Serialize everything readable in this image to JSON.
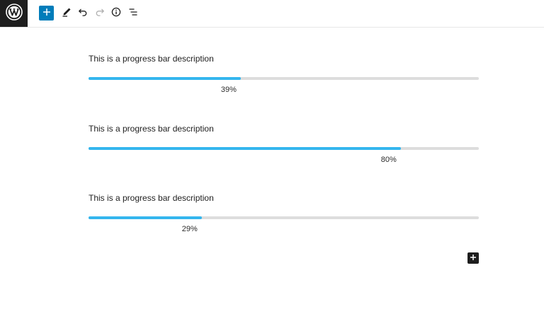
{
  "toolbar": {
    "logo_icon": "wordpress-logo-icon",
    "buttons": [
      {
        "name": "add-block-button",
        "icon": "plus-icon"
      },
      {
        "name": "edit-tools-button",
        "icon": "pencil-icon"
      },
      {
        "name": "undo-button",
        "icon": "undo-icon"
      },
      {
        "name": "redo-button",
        "icon": "redo-icon"
      },
      {
        "name": "details-button",
        "icon": "info-icon"
      },
      {
        "name": "list-view-button",
        "icon": "list-view-icon"
      }
    ],
    "accent_color": "#007cba"
  },
  "progress_bars": [
    {
      "description": "This is a progress bar description",
      "value": 39,
      "label": "39%"
    },
    {
      "description": "This is a progress bar description",
      "value": 80,
      "label": "80%"
    },
    {
      "description": "This is a progress bar description",
      "value": 29,
      "label": "29%"
    }
  ],
  "colors": {
    "bar_fill": "#34b6ee",
    "bar_track": "#dddddd"
  },
  "inserter": {
    "icon": "plus-icon"
  }
}
